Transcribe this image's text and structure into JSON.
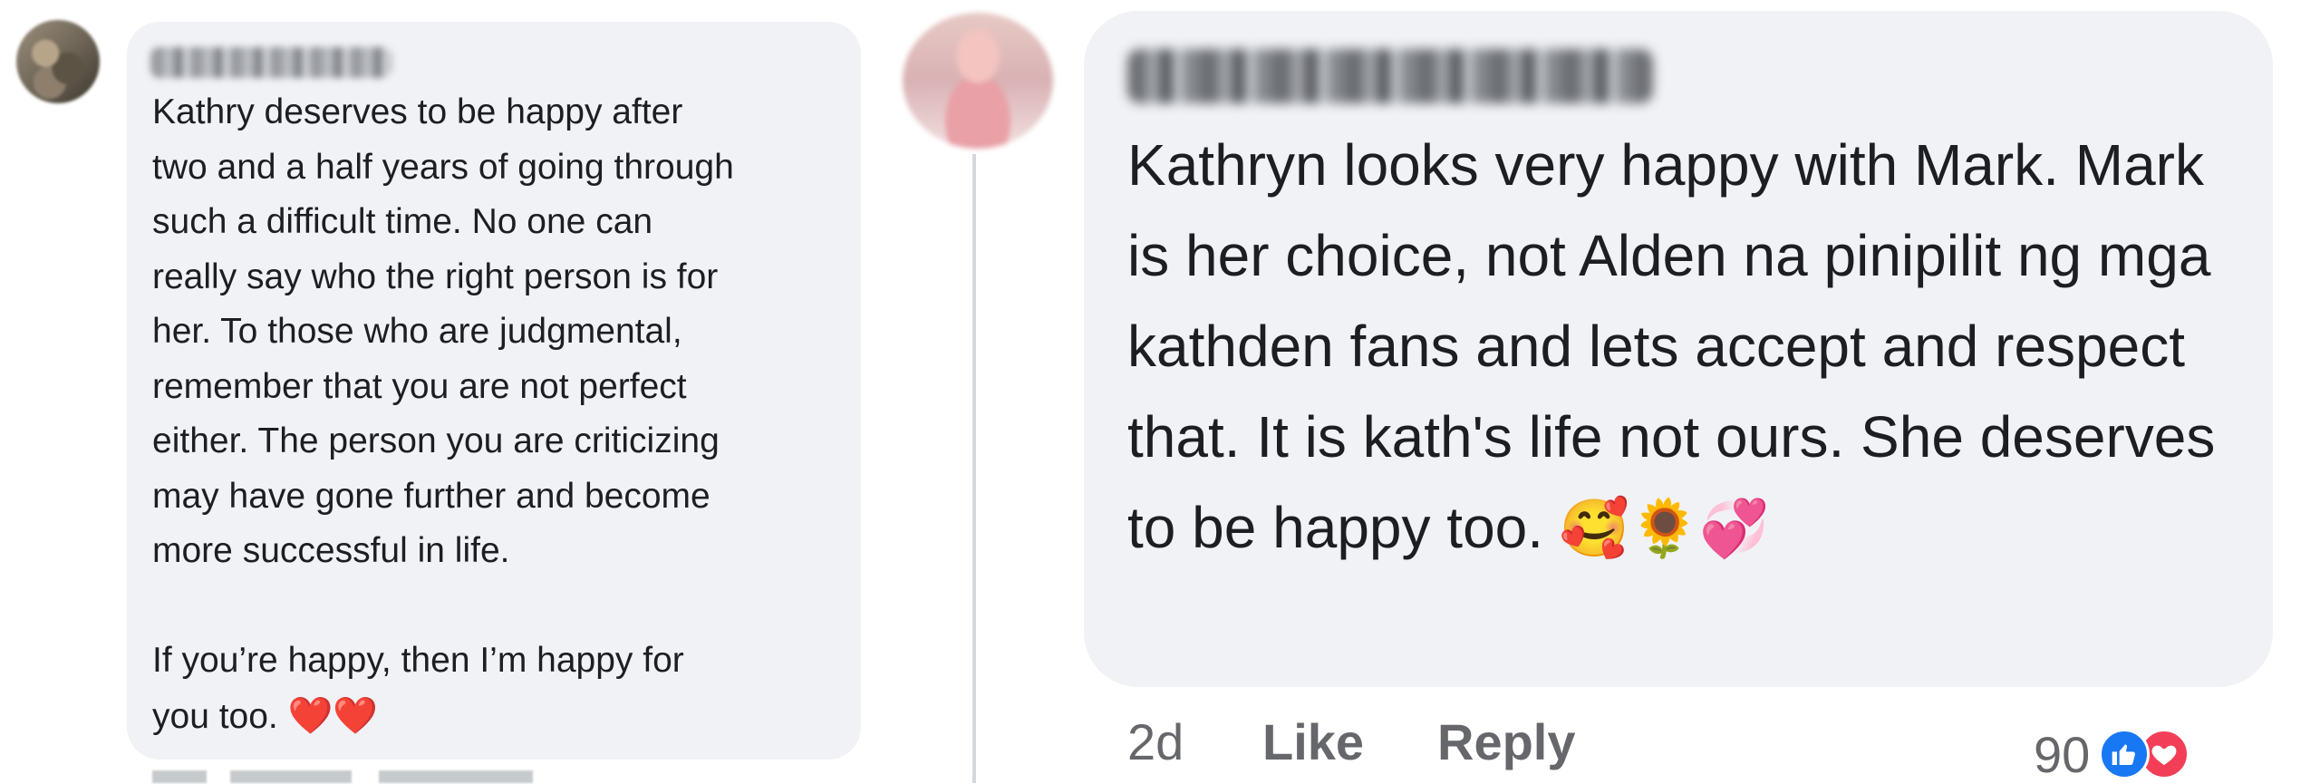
{
  "left_comment": {
    "text": "Kathry deserves to be happy after\ntwo and a half years of going through\nsuch a difficult time. No one can\nreally say who the right person is for\nher. To those who are judgmental,\nremember that you are not perfect\neither. The person you are criticizing\nmay have gone further and become\nmore successful in life.\n\nIf you’re happy, then I’m happy for\nyou too. ",
    "emoji": "❤️❤️"
  },
  "right_comment": {
    "text": "Kathryn looks very happy with Mark. Mark is her choice, not Alden na pinipilit ng mga kathden fans and lets accept and respect that. It is kath's life not ours. She deserves to be happy too. ",
    "emoji": "🥰🌻💞",
    "time": "2d",
    "like_label": "Like",
    "reply_label": "Reply",
    "reaction_count": "90"
  },
  "colors": {
    "bubble": "#f0f2f5",
    "meta_text": "#65676b",
    "like_blue": "#1877f2",
    "love_red": "#f33e58"
  },
  "icons": [
    "like-reaction-icon",
    "love-reaction-icon"
  ]
}
